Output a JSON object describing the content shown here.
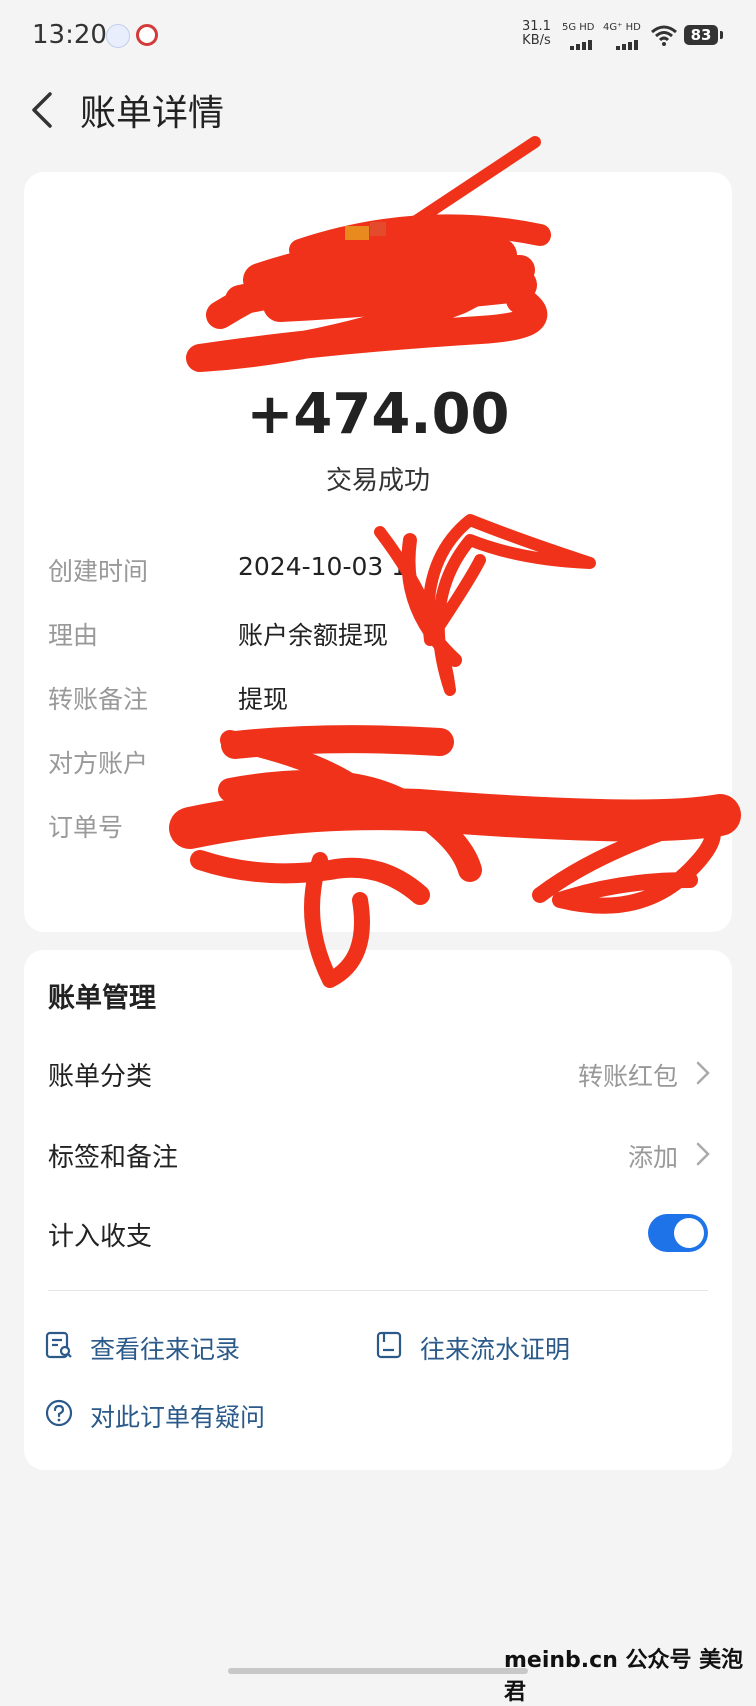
{
  "status_bar": {
    "time": "13:20",
    "net_speed_value": "31.1",
    "net_speed_unit": "KB/s",
    "sim1": "5G HD",
    "sim2": "4G⁺ HD",
    "battery": "83"
  },
  "header": {
    "title": "账单详情"
  },
  "summary": {
    "amount": "+474.00",
    "status": "交易成功"
  },
  "details": [
    {
      "label": "创建时间",
      "value": "2024-10-03 1"
    },
    {
      "label": "理由",
      "value": "账户余额提现"
    },
    {
      "label": "转账备注",
      "value": "提现"
    },
    {
      "label": "对方账户",
      "value": ""
    },
    {
      "label": "订单号",
      "value": ""
    }
  ],
  "management": {
    "title": "账单管理",
    "category_label": "账单分类",
    "category_value": "转账红包",
    "tags_label": "标签和备注",
    "tags_value": "添加",
    "include_label": "计入收支",
    "include_on": true,
    "records_link": "查看往来记录",
    "statement_link": "往来流水证明",
    "question_link": "对此订单有疑问"
  },
  "colors": {
    "accent": "#1e73e8",
    "link": "#2b5a8a",
    "redaction": "#f0321a"
  },
  "watermark": "meinb.cn  公众号 美泡君"
}
